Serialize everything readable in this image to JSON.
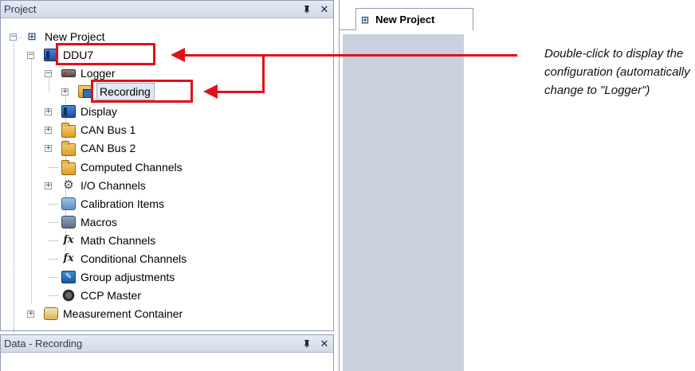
{
  "project_panel": {
    "title": "Project",
    "pin_glyph": "ᴘ",
    "close_glyph": "✕",
    "tree": {
      "root": "New Project",
      "device": "DDU7",
      "logger": "Logger",
      "recording": "Recording",
      "display": "Display",
      "can_bus_1": "CAN Bus 1",
      "can_bus_2": "CAN Bus 2",
      "computed_channels": "Computed Channels",
      "io_channels": "I/O Channels",
      "calibration_items": "Calibration Items",
      "macros": "Macros",
      "math_channels": "Math Channels",
      "conditional_channels": "Conditional Channels",
      "group_adjustments": "Group adjustments",
      "ccp_master": "CCP Master",
      "measurement_container": "Measurement Container"
    }
  },
  "data_panel": {
    "title": "Data - Recording",
    "close_glyph": "✕"
  },
  "document": {
    "tab_label": "New Project"
  },
  "annotation": {
    "text": "Double-click to display the configuration (automatically change to \"Logger\")",
    "color": "#e1101a"
  },
  "icons": {
    "expand": "⊞",
    "collapse": "⊟",
    "fx": "fx",
    "io": "⚙",
    "wrench": "🔧"
  }
}
